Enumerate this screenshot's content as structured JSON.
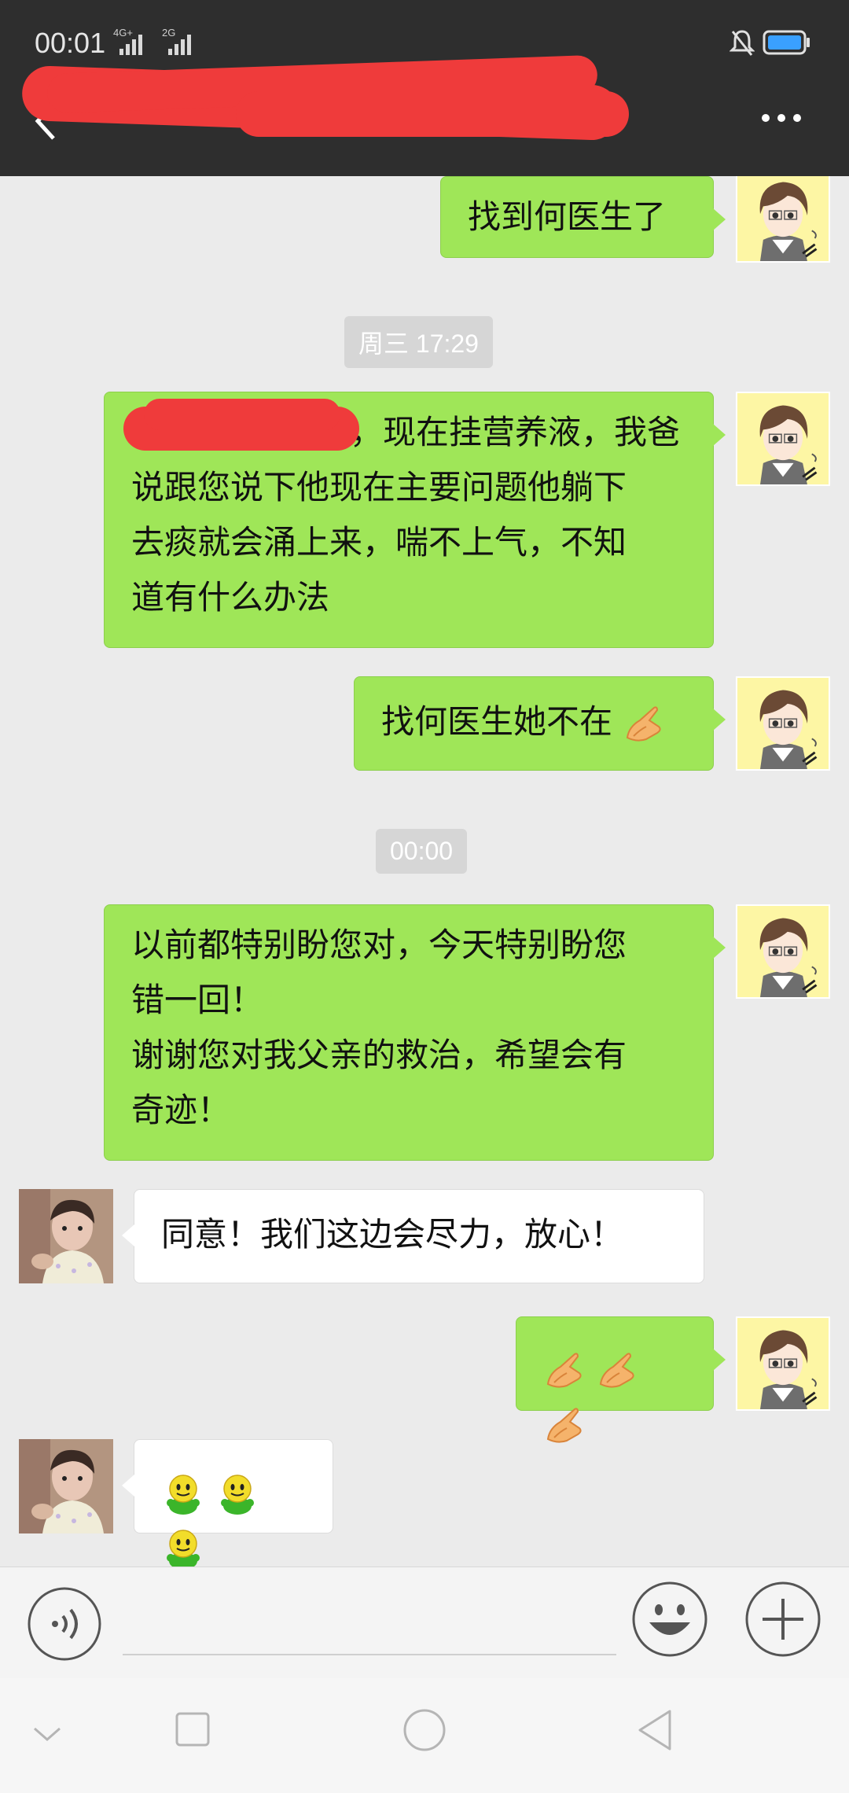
{
  "status_bar": {
    "time": "00:01",
    "signals": [
      {
        "network": "4G+"
      },
      {
        "network": "2G"
      }
    ],
    "icons": [
      "bell-muted-icon",
      "battery-icon"
    ]
  },
  "header": {
    "title": "",
    "icons": [
      "back-icon",
      "more-icon"
    ]
  },
  "messages": [
    {
      "type": "text",
      "from": "me",
      "text": "找到何医生了"
    },
    {
      "type": "time",
      "text": "周三 17:29"
    },
    {
      "type": "text",
      "from": "me",
      "lines": [
        "，现在挂营养液，我爸",
        "说跟您说下他现在主要问题他躺下",
        "去痰就会涌上来，喘不上气，不知",
        "道有什么办法"
      ]
    },
    {
      "type": "text",
      "from": "me",
      "text": "找何医生她不在"
    },
    {
      "type": "time",
      "text": "00:00"
    },
    {
      "type": "text",
      "from": "me",
      "lines": [
        "以前都特别盼您对，今天特别盼您",
        "错一回！",
        "谢谢您对我父亲的救治，希望会有",
        "奇迹！"
      ]
    },
    {
      "type": "text",
      "from": "other",
      "text": "同意！我们这边会尽力，放心！"
    },
    {
      "type": "emoji",
      "from": "me",
      "emoji": [
        "pray-hands-icon",
        "pray-hands-icon",
        "pray-hands-icon"
      ]
    },
    {
      "type": "emoji",
      "from": "other",
      "emoji": [
        "green-smiley-icon",
        "green-smiley-icon",
        "green-smiley-icon"
      ]
    }
  ],
  "input_bar": {
    "placeholder": "",
    "icons": [
      "voice-icon",
      "emoji-icon",
      "plus-icon"
    ]
  },
  "nav_bar": {
    "icons": [
      "chevron-down-icon",
      "recents-square-icon",
      "home-circle-icon",
      "back-triangle-icon"
    ]
  },
  "colors": {
    "header_bg": "#2e2e2e",
    "chat_bg": "#ebebeb",
    "my_bubble": "#9fe658",
    "other_bubble": "#ffffff",
    "redaction": "#ef3b3b"
  }
}
